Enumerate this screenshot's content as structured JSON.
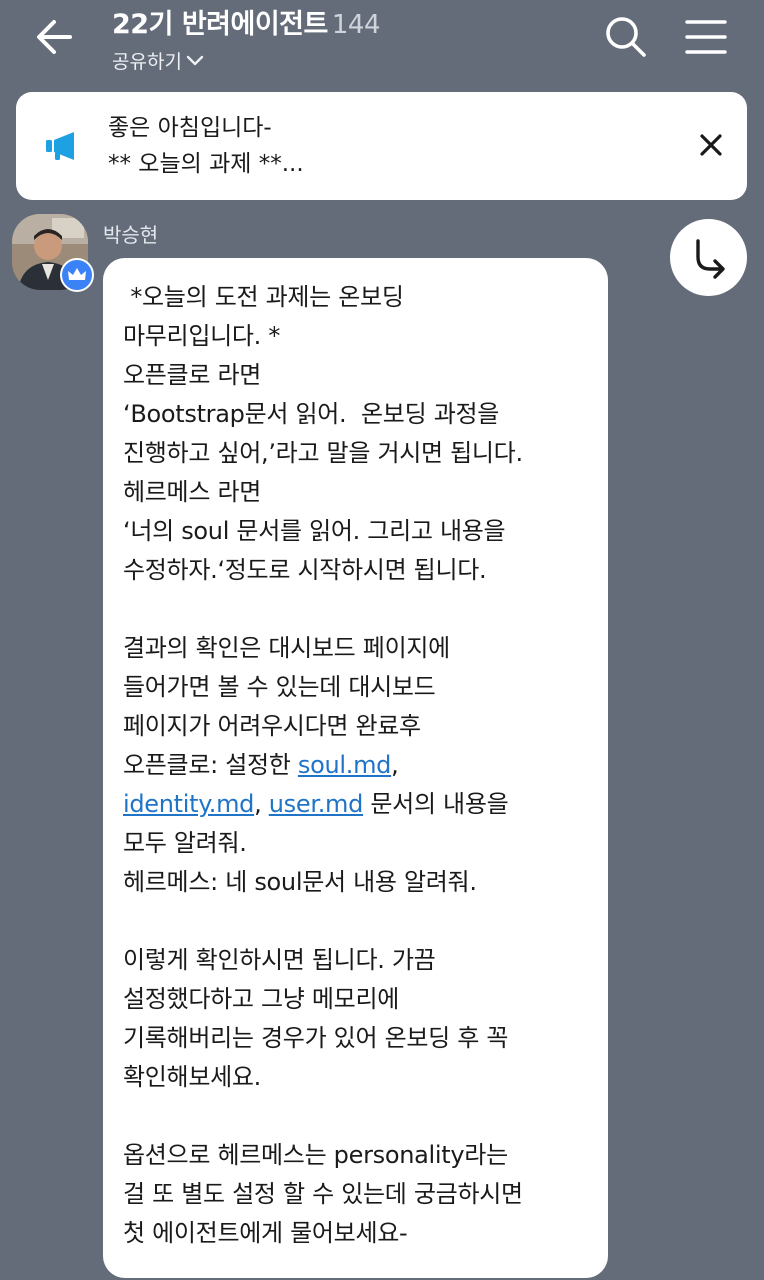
{
  "header": {
    "title": "22기 반려에이전트",
    "member_count": "144",
    "share_label": "공유하기"
  },
  "notice": {
    "line1": "좋은 아침입니다-",
    "line2": "** 오늘의 과제 **..."
  },
  "message": {
    "sender": "박승현",
    "lines": [
      " *오늘의 도전 과제는 온보딩",
      "마무리입니다. *",
      "오픈클로 라면",
      "‘Bootstrap문서 읽어.  온보딩 과정을",
      "진행하고 싶어,’라고 말을 거시면 됩니다.",
      "헤르메스 라면",
      "‘너의 soul 문서를 읽어. 그리고 내용을",
      "수정하자.‘정도로 시작하시면 됩니다.",
      "",
      "결과의 확인은 대시보드 페이지에",
      "들어가면 볼 수 있는데 대시보드",
      "페이지가 어려우시다면 완료후"
    ],
    "line_openclaw_prefix": "오픈클로: 설정한 ",
    "link_soul": "soul.md",
    "comma1": ",",
    "link_identity": "identity.md",
    "comma2": ", ",
    "link_user": "user.md",
    "line_docs_suffix": " 문서의 내용을",
    "lines_after": [
      "모두 알려줘.",
      "헤르메스: 네 soul문서 내용 알려줘.",
      "",
      "이렇게 확인하시면 됩니다. 가끔",
      "설정했다하고 그냥 메모리에",
      "기록해버리는 경우가 있어 온보딩 후 꼭",
      "확인해보세요.",
      "",
      "옵션으로 헤르메스는 personality라는",
      "걸 또 별도 설정 할 수 있는데 궁금하시면",
      "첫 에이전트에게 물어보세요-"
    ]
  },
  "icons": {
    "back": "arrow-left-icon",
    "search": "search-icon",
    "menu": "hamburger-menu-icon",
    "notice": "megaphone-icon",
    "close": "close-icon",
    "share": "share-forward-icon",
    "badge": "crown-icon"
  },
  "colors": {
    "background": "#646c7a",
    "link": "#1f74c8",
    "notice_icon": "#1da1e2",
    "badge": "#3b82f6"
  }
}
